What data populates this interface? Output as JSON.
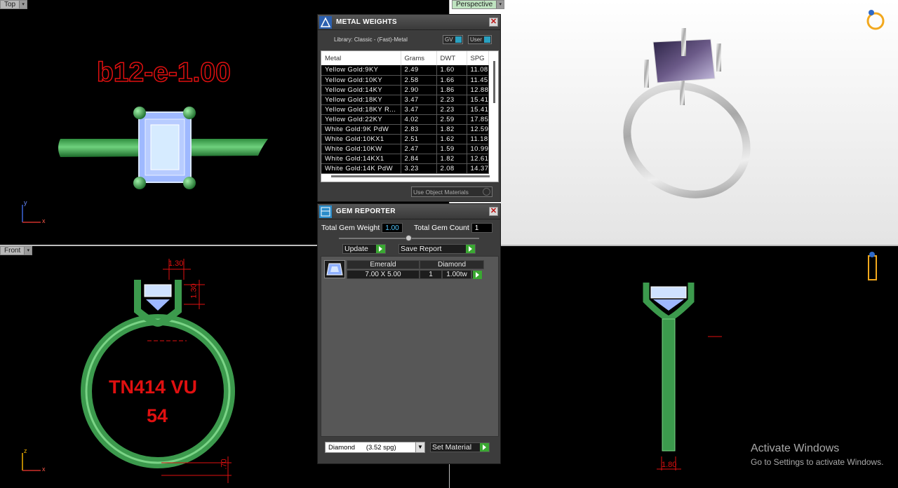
{
  "viewports": {
    "top": {
      "label": "Top",
      "annotation": "b12-e-1.00"
    },
    "perspective": {
      "label": "Perspective"
    },
    "front": {
      "label": "Front",
      "annotation_line1": "TN414 VU",
      "annotation_line2": "54",
      "dim_top": "1.30",
      "dim_prong": "1.30",
      "dim_bottom": ".70"
    },
    "side": {
      "dim_bottom": "1.80"
    }
  },
  "axes": {
    "x": "x",
    "y": "y",
    "z": "z"
  },
  "metal_weights": {
    "title": "METAL WEIGHTS",
    "library": "Library: Classic - (Fast)-Metal",
    "gv_label": "GV",
    "user_label": "User",
    "columns": [
      "Metal",
      "Grams",
      "DWT",
      "SPG"
    ],
    "rows": [
      [
        "Yellow Gold:9KY",
        "2.49",
        "1.60",
        "11.08"
      ],
      [
        "Yellow Gold:10KY",
        "2.58",
        "1.66",
        "11.45"
      ],
      [
        "Yellow Gold:14KY",
        "2.90",
        "1.86",
        "12.88"
      ],
      [
        "Yellow Gold:18KY",
        "3.47",
        "2.23",
        "15.41"
      ],
      [
        "Yellow Gold:18KY R...",
        "3.47",
        "2.23",
        "15.41"
      ],
      [
        "Yellow Gold:22KY",
        "4.02",
        "2.59",
        "17.85"
      ],
      [
        "White Gold:9K PdW",
        "2.83",
        "1.82",
        "12.59"
      ],
      [
        "White Gold:10KX1",
        "2.51",
        "1.62",
        "11.18"
      ],
      [
        "White Gold:10KW",
        "2.47",
        "1.59",
        "10.99"
      ],
      [
        "White Gold:14KX1",
        "2.84",
        "1.82",
        "12.61"
      ],
      [
        "White Gold:14K PdW",
        "3.23",
        "2.08",
        "14.37"
      ]
    ],
    "use_object_materials": "Use Object Materials"
  },
  "gem_reporter": {
    "title": "GEM REPORTER",
    "total_weight_label": "Total Gem Weight",
    "total_weight": "1.00",
    "total_count_label": "Total Gem Count",
    "total_count": "1",
    "update_label": "Update",
    "save_report_label": "Save Report",
    "gem": {
      "shape": "Emerald",
      "material": "Diamond",
      "size": "7.00 X 5.00",
      "count": "1",
      "weight": "1.00tw"
    },
    "material_select": "Diamond      (3.52 spg)",
    "set_material_label": "Set Material"
  },
  "watermark": {
    "line1": "Activate Windows",
    "line2": "Go to Settings to activate Windows."
  },
  "colors": {
    "metal_green": "#3a9a4c",
    "annotation_red": "#e01010",
    "gem_blue": "#cfe8ff",
    "accent_cyan": "#54c8ff"
  }
}
